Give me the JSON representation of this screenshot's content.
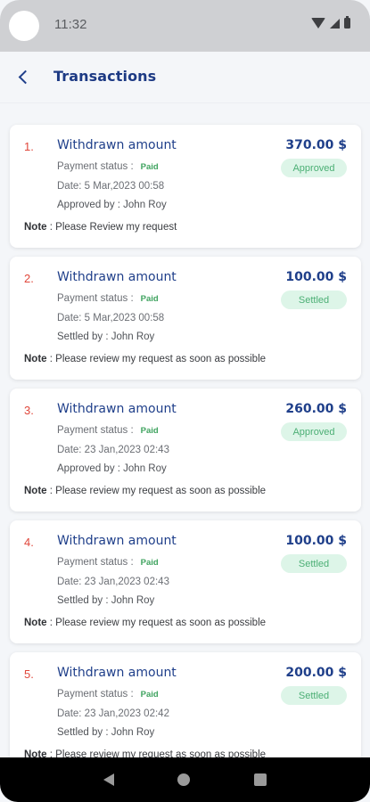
{
  "status_bar": {
    "time": "11:32"
  },
  "header": {
    "title": "Transactions"
  },
  "transactions": [
    {
      "index": "1.",
      "title": "Withdrawn amount",
      "amount": "370.00 $",
      "badge": "Approved",
      "payment_status_label": "Payment status :",
      "payment_status": "Paid",
      "date": "Date:  5 Mar,2023 00:58",
      "by": "Approved by : John Roy",
      "note_label": "Note",
      "note": " : Please Review my request"
    },
    {
      "index": "2.",
      "title": "Withdrawn amount",
      "amount": "100.00 $",
      "badge": "Settled",
      "payment_status_label": "Payment status :",
      "payment_status": "Paid",
      "date": "Date:  5 Mar,2023 00:58",
      "by": "Settled by : John Roy",
      "note_label": "Note",
      "note": " : Please review my request as soon as possible"
    },
    {
      "index": "3.",
      "title": "Withdrawn amount",
      "amount": "260.00 $",
      "badge": "Approved",
      "payment_status_label": "Payment status :",
      "payment_status": "Paid",
      "date": "Date:  23 Jan,2023 02:43",
      "by": "Approved by : John Roy",
      "note_label": "Note",
      "note": " : Please review my request as soon as possible"
    },
    {
      "index": "4.",
      "title": "Withdrawn amount",
      "amount": "100.00 $",
      "badge": "Settled",
      "payment_status_label": "Payment status :",
      "payment_status": "Paid",
      "date": "Date:  23 Jan,2023 02:43",
      "by": "Settled by : John Roy",
      "note_label": "Note",
      "note": " : Please review my request as soon as possible"
    },
    {
      "index": "5.",
      "title": "Withdrawn amount",
      "amount": "200.00 $",
      "badge": "Settled",
      "payment_status_label": "Payment status :",
      "payment_status": "Paid",
      "date": "Date:  23 Jan,2023 02:42",
      "by": "Settled by : John Roy",
      "note_label": "Note",
      "note": " : Please review my request as soon as possible"
    }
  ],
  "colors": {
    "accent": "#1f3f8a",
    "index": "#e0473b",
    "badge_bg": "#ddf5e8",
    "badge_text": "#4caf75",
    "paid": "#3fa35f"
  },
  "icons": {
    "back": "chevron-left-icon",
    "nav_back": "triangle-back-icon",
    "nav_home": "circle-home-icon",
    "nav_recent": "square-recent-icon"
  }
}
